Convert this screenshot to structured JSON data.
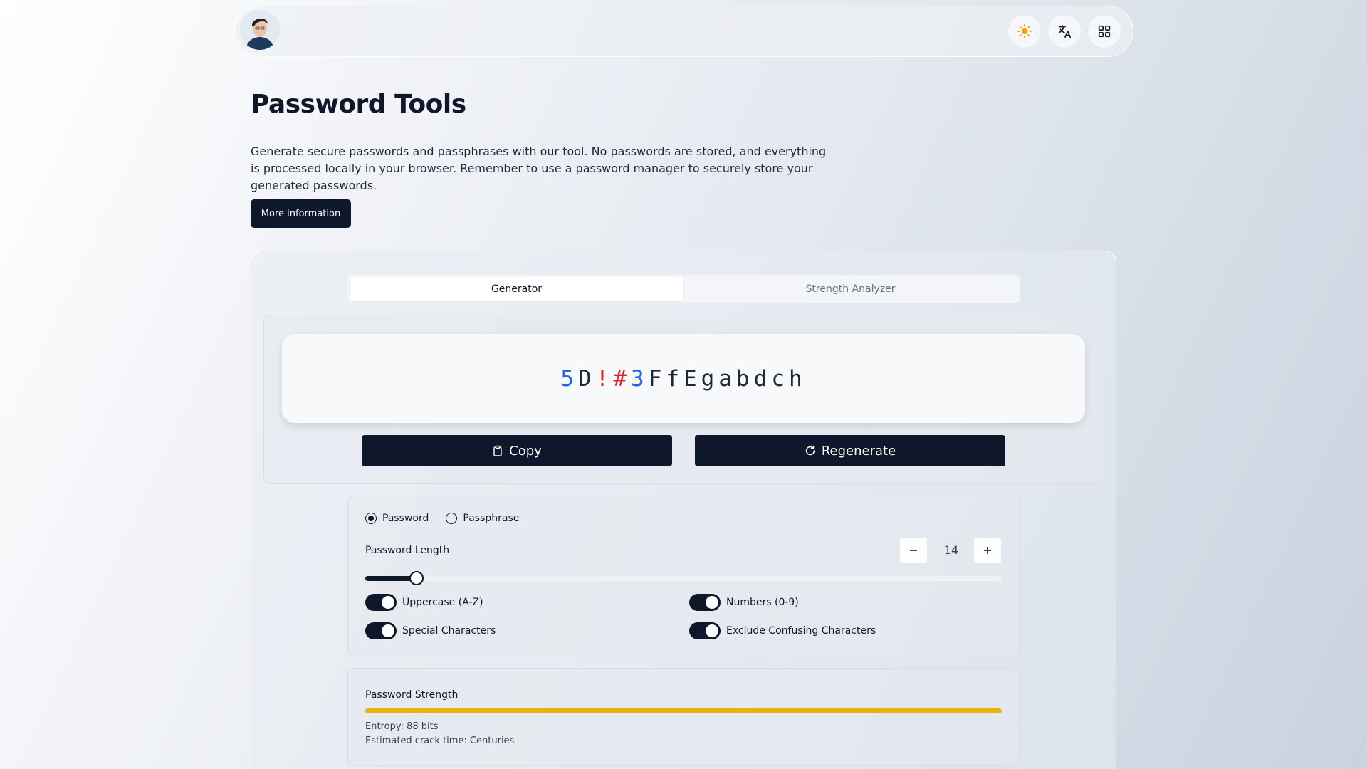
{
  "header": {
    "avatar_alt": "profile avatar",
    "theme_icon": "sun-icon",
    "language_icon": "translate-icon",
    "apps_icon": "grid-icon"
  },
  "page": {
    "title": "Password Tools",
    "intro": "Generate secure passwords and passphrases with our tool. No passwords are stored, and everything is processed locally in your browser. Remember to use a password manager to securely store your generated passwords.",
    "more_button": "More information"
  },
  "tabs": [
    {
      "label": "Generator",
      "active": true
    },
    {
      "label": "Strength Analyzer",
      "active": false
    }
  ],
  "generator": {
    "password_parts": [
      {
        "text": "5",
        "kind": "num"
      },
      {
        "text": "D",
        "kind": "char"
      },
      {
        "text": "!",
        "kind": "sym"
      },
      {
        "text": "#",
        "kind": "sym"
      },
      {
        "text": "3",
        "kind": "num"
      },
      {
        "text": "FfEgabdch",
        "kind": "char"
      }
    ],
    "copy_label": "Copy",
    "regenerate_label": "Regenerate"
  },
  "options": {
    "mode_password": "Password",
    "mode_passphrase": "Passphrase",
    "selected_mode": "Password",
    "length_label": "Password Length",
    "length_value": "14",
    "length_min": 4,
    "length_max": 128,
    "uppercase_label": "Uppercase (A-Z)",
    "numbers_label": "Numbers (0-9)",
    "special_label": "Special Characters",
    "exclude_label": "Exclude Confusing Characters"
  },
  "strength": {
    "title": "Password Strength",
    "entropy": "Entropy: 88 bits",
    "crack_time": "Estimated crack time: Centuries",
    "level": 1.0,
    "color": "#eab308"
  },
  "colors": {
    "primary": "#0f172a",
    "number_highlight": "#2563eb",
    "symbol_highlight": "#dc2626",
    "strength_bar": "#eab308"
  }
}
